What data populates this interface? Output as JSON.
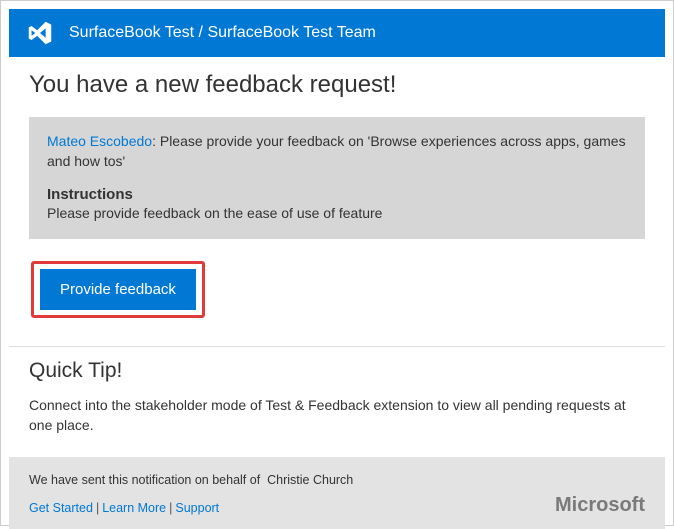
{
  "header": {
    "title": "SurfaceBook Test / SurfaceBook Test Team"
  },
  "main": {
    "page_title": "You have a new feedback request!",
    "request": {
      "requester_name": "Mateo Escobedo",
      "message": ": Please provide your feedback on 'Browse experiences across  apps, games and how tos'",
      "instructions_heading": "Instructions",
      "instructions_text": "Please provide feedback on the ease of use of feature"
    },
    "cta_label": "Provide feedback"
  },
  "tip": {
    "title": "Quick Tip!",
    "text": "Connect into the stakeholder mode of Test & Feedback extension to view all pending requests at one place."
  },
  "footer": {
    "sent_prefix": "We have sent this notification on behalf of ",
    "sent_name": "Christie Church",
    "links": {
      "get_started": "Get Started",
      "learn_more": "Learn More",
      "support": "Support"
    },
    "brand": "Microsoft"
  }
}
